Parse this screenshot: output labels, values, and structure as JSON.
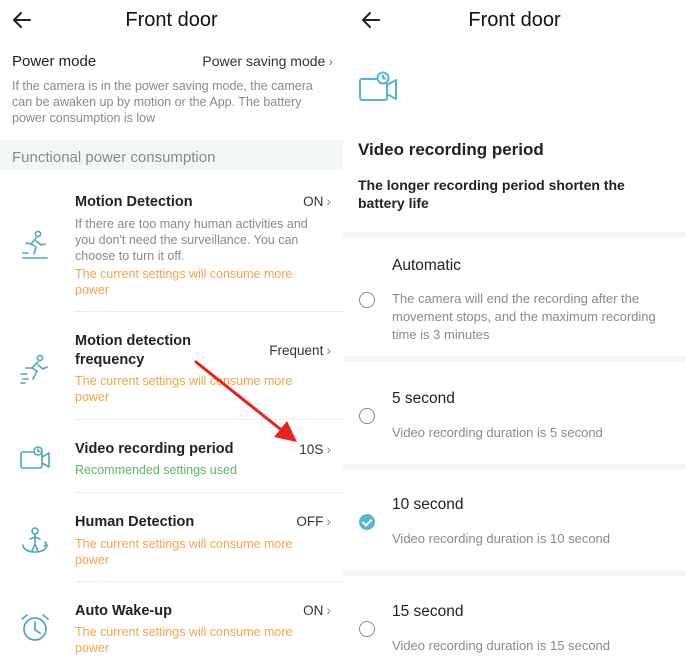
{
  "left": {
    "title": "Front door",
    "power_mode": {
      "label": "Power mode",
      "value": "Power saving mode",
      "description": "If the camera is in the power saving mode, the camera can be awaken up by motion or the App. The battery power consumption is low"
    },
    "section_title": "Functional power consumption",
    "items": [
      {
        "icon": "running-person-icon",
        "title": "Motion Detection",
        "value": "ON",
        "description": "If there are too many human activities and you don't need the surveillance. You can choose to turn it off.",
        "note": "The current settings will consume more power"
      },
      {
        "icon": "fast-running-person-icon",
        "title": "Motion detection frequency",
        "value": "Frequent",
        "note": "The current settings will consume more power"
      },
      {
        "icon": "video-camera-clock-icon",
        "title": "Video recording period",
        "value": "10S",
        "note": "Recommended settings used"
      },
      {
        "icon": "human-detection-icon",
        "title": "Human Detection",
        "value": "OFF",
        "note": "The current settings will consume more power"
      },
      {
        "icon": "alarm-clock-icon",
        "title": "Auto Wake-up",
        "value": "ON",
        "note": "The current settings will consume more power"
      }
    ]
  },
  "right": {
    "title": "Front door",
    "heading": "Video recording period",
    "subheading": "The longer recording period shorten the battery life",
    "options": [
      {
        "title": "Automatic",
        "description": "The camera will end the recording after the movement stops, and the maximum recording time is 3 minutes",
        "selected": false
      },
      {
        "title": "5 second",
        "description": "Video recording duration is 5 second",
        "selected": false
      },
      {
        "title": "10 second",
        "description": "Video recording duration is 10 second",
        "selected": true
      },
      {
        "title": "15 second",
        "description": "Video recording duration is 15 second",
        "selected": false
      }
    ]
  },
  "colors": {
    "accent": "#56b8d0",
    "warning": "#f3a64a",
    "ok": "#5bb86a",
    "annotation_arrow": "#e8231f",
    "section_band": "#f2f8f8"
  },
  "chevron_glyph": "›"
}
